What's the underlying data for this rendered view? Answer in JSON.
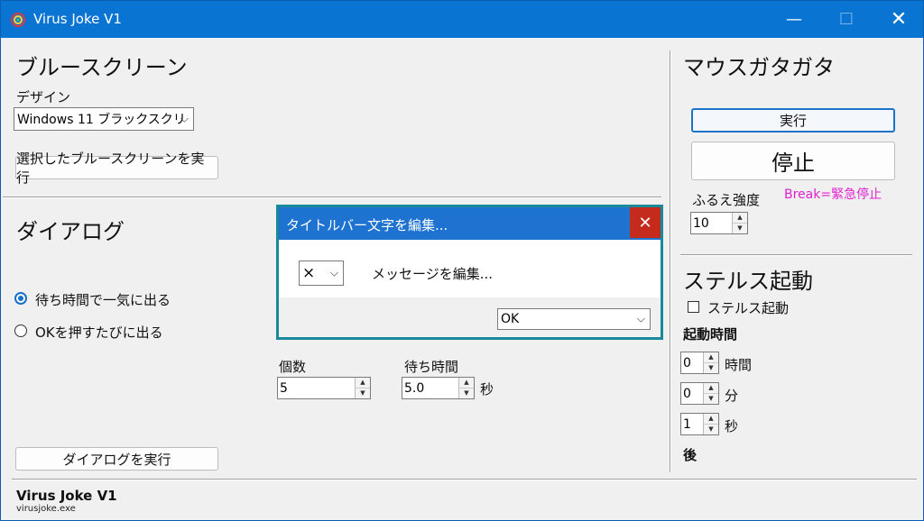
{
  "window": {
    "title": "Virus Joke V1"
  },
  "bluescreen": {
    "heading": "ブルースクリーン",
    "design_label": "デザイン",
    "design_value": "Windows 11 ブラックスクリ",
    "run_button": "選択したブルースクリーンを実行"
  },
  "dialog": {
    "heading": "ダイアログ",
    "radio_wait": "待ち時間で一気に出る",
    "radio_ok": "OKを押すたびに出る",
    "count_label": "個数",
    "count_value": "5",
    "wait_label": "待ち時間",
    "wait_value": "5.0",
    "wait_unit": "秒",
    "run_button": "ダイアログを実行",
    "preview": {
      "title": "タイトルバー文字を編集...",
      "icon_value": "×",
      "message": "メッセージを編集...",
      "button_value": "OK"
    }
  },
  "mouse": {
    "heading": "マウスガタガタ",
    "run_button": "実行",
    "stop_button": "停止",
    "strength_label": "ふるえ強度",
    "break_hint": "Break=緊急停止",
    "strength_value": "10"
  },
  "stealth": {
    "heading": "ステルス起動",
    "checkbox_label": "ステルス起動",
    "time_label": "起動時間",
    "hours_value": "0",
    "hours_unit": "時間",
    "minutes_value": "0",
    "minutes_unit": "分",
    "seconds_value": "1",
    "seconds_unit": "秒",
    "after_label": "後"
  },
  "footer": {
    "app_name": "Virus Joke V1",
    "exe_name": "virusjoke.exe"
  },
  "colors": {
    "titlebar": "#0a74d2",
    "break_hint": "#e020d0",
    "close_red": "#c42b1c"
  }
}
